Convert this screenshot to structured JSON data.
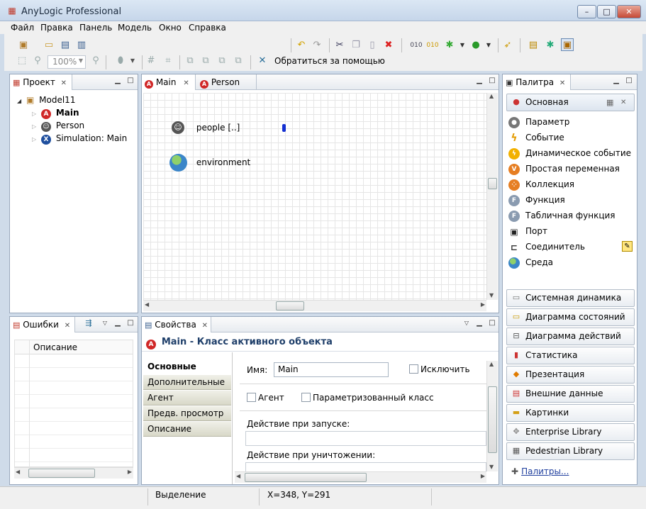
{
  "app": {
    "title": "AnyLogic Professional"
  },
  "window_controls": {
    "minimize": "–",
    "maximize": "□",
    "close": "✕"
  },
  "menu": [
    "Файл",
    "Правка",
    "Панель",
    "Модель",
    "Окно",
    "Справка"
  ],
  "toolbar": {
    "zoom_value": "100%",
    "help_label": "Обратиться за помощью"
  },
  "project_panel": {
    "title": "Проект",
    "tree": [
      {
        "label": "Model11",
        "icon": "model-icon",
        "expanded": true,
        "level": 0
      },
      {
        "label": "Main",
        "icon": "active-object-icon",
        "bold": true,
        "level": 1
      },
      {
        "label": "Person",
        "icon": "person-class-icon",
        "level": 1
      },
      {
        "label": "Simulation: Main",
        "icon": "experiment-icon",
        "level": 1
      }
    ]
  },
  "editor": {
    "tabs": [
      "Main",
      "Person"
    ],
    "objects": [
      {
        "label": "people [..]",
        "icon": "agent-population-icon"
      },
      {
        "label": "environment",
        "icon": "environment-globe-icon"
      }
    ]
  },
  "errors_panel": {
    "title": "Ошибки",
    "column_header": "Описание"
  },
  "properties_panel": {
    "title": "Свойства",
    "heading": "Main - Класс активного объекта",
    "tabs": [
      "Основные",
      "Дополнительные",
      "Агент",
      "Предв. просмотр",
      "Описание"
    ],
    "active_tab": "Основные",
    "name_label": "Имя:",
    "name_value": "Main",
    "exclude_label": "Исключить",
    "agent_label": "Агент",
    "parametrized_label": "Параметризованный класс",
    "on_startup_label": "Действие при запуске:",
    "on_destroy_label": "Действие при уничтожении:"
  },
  "palette": {
    "title": "Палитра",
    "section": "Основная",
    "items": [
      {
        "label": "Параметр",
        "icon": "parameter-icon"
      },
      {
        "label": "Событие",
        "icon": "event-lightning-icon"
      },
      {
        "label": "Динамическое событие",
        "icon": "dynamic-event-icon"
      },
      {
        "label": "Простая переменная",
        "icon": "variable-icon"
      },
      {
        "label": "Коллекция",
        "icon": "collection-icon"
      },
      {
        "label": "Функция",
        "icon": "function-icon"
      },
      {
        "label": "Табличная функция",
        "icon": "table-function-icon"
      },
      {
        "label": "Порт",
        "icon": "port-icon"
      },
      {
        "label": "Соединитель",
        "icon": "connector-icon"
      },
      {
        "label": "Среда",
        "icon": "environment-icon"
      }
    ],
    "sections": [
      "Системная динамика",
      "Диаграмма состояний",
      "Диаграмма действий",
      "Статистика",
      "Презентация",
      "Внешние данные",
      "Картинки",
      "Enterprise Library",
      "Pedestrian Library"
    ],
    "more_link": "Палитры..."
  },
  "status": {
    "mode": "Выделение",
    "coords": "X=348, Y=291"
  }
}
